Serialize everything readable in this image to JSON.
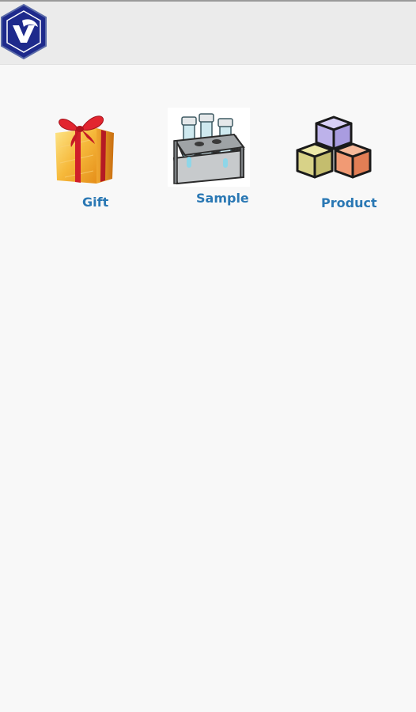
{
  "header": {
    "logo_icon": "app-logo-hexagon-icon"
  },
  "menu": {
    "items": [
      {
        "label": "Gift",
        "icon": "gift-box-icon"
      },
      {
        "label": "Sample",
        "icon": "test-tube-rack-icon"
      },
      {
        "label": "Product",
        "icon": "stacked-cubes-icon"
      }
    ]
  },
  "colors": {
    "label": "#2a78b4",
    "header_bg": "#ebebeb",
    "content_bg": "#f8f8f8",
    "logo_blue": "#1e2a8c"
  }
}
